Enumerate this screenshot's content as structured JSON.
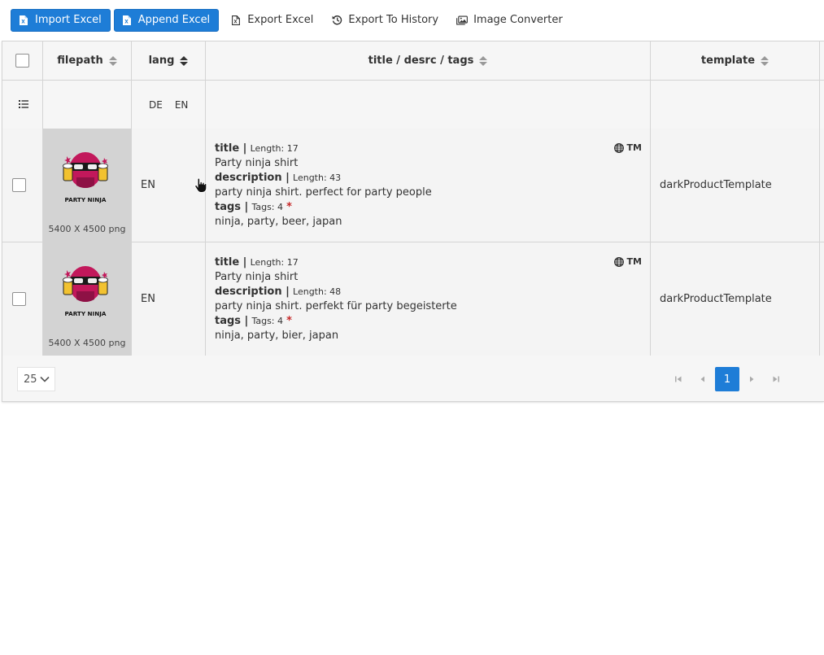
{
  "toolbar": {
    "buttons": [
      {
        "label": "Import Excel",
        "icon": "excel-file-icon",
        "style": "primary"
      },
      {
        "label": "Append Excel",
        "icon": "excel-file-icon",
        "style": "primary"
      },
      {
        "label": "Export Excel",
        "icon": "excel-file-outline-icon",
        "style": "plain"
      },
      {
        "label": "Export To History",
        "icon": "history-icon",
        "style": "plain"
      },
      {
        "label": "Image Converter",
        "icon": "images-icon",
        "style": "plain"
      }
    ]
  },
  "table": {
    "columns": [
      "filepath",
      "lang",
      "title / desrc / tags",
      "template"
    ],
    "lang_filter": [
      "DE",
      "EN"
    ],
    "rows": [
      {
        "image_text": "PARTY NINJA",
        "dimensions": "5400 X 4500 png",
        "lang": "EN",
        "title_label": "title |",
        "title_meta": "Length: 17",
        "title": "Party ninja shirt",
        "desc_label": "description |",
        "desc_meta": "Length: 43",
        "description": "party ninja shirt. perfect for party people",
        "tags_label": "tags |",
        "tags_meta": "Tags: 4",
        "tags_marker": "*",
        "tags": "ninja, party, beer, japan",
        "badge": "TM",
        "template": "darkProductTemplate"
      },
      {
        "image_text": "PARTY NINJA",
        "dimensions": "5400 X 4500 png",
        "lang": "EN",
        "title_label": "title |",
        "title_meta": "Length: 17",
        "title": "Party ninja shirt",
        "desc_label": "description |",
        "desc_meta": "Length: 48",
        "description": "party ninja shirt. perfekt für party begeisterte",
        "tags_label": "tags |",
        "tags_meta": "Tags: 4",
        "tags_marker": "*",
        "tags": "ninja, party, bier, japan",
        "badge": "TM",
        "template": "darkProductTemplate"
      }
    ]
  },
  "pager": {
    "page_size": "25",
    "current_page": "1"
  },
  "colors": {
    "accent": "#1e7dd7",
    "required_marker": "#c62828",
    "ninja": "#c2185b"
  }
}
